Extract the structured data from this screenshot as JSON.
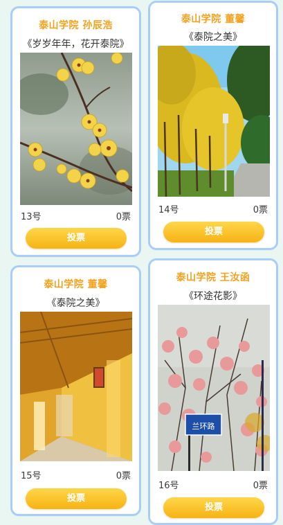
{
  "cards": [
    {
      "author": "泰山学院 孙辰浩",
      "title": "《岁岁年年，花开泰院》",
      "number": "13号",
      "votes": "0票",
      "vote_label": "投票",
      "photo": "wintersweet-blossom-photo"
    },
    {
      "author": "泰山学院 董馨",
      "title": "《泰院之美》",
      "number": "14号",
      "votes": "0票",
      "vote_label": "投票",
      "photo": "ginkgo-avenue-photo"
    },
    {
      "author": "泰山学院 董馨",
      "title": "《泰院之美》",
      "number": "15号",
      "votes": "0票",
      "vote_label": "投票",
      "photo": "sunlit-corridor-photo"
    },
    {
      "author": "泰山学院 王汝函",
      "title": "《环途花影》",
      "number": "16号",
      "votes": "0票",
      "vote_label": "投票",
      "photo": "plum-blossom-sign-photo",
      "sign_text": "兰环路"
    }
  ],
  "colors": {
    "background": "#e9f6f2",
    "card_border": "#a9cdf6",
    "author_text": "#f2a21e",
    "button_top": "#ffd64a",
    "button_bottom": "#f6b314"
  }
}
